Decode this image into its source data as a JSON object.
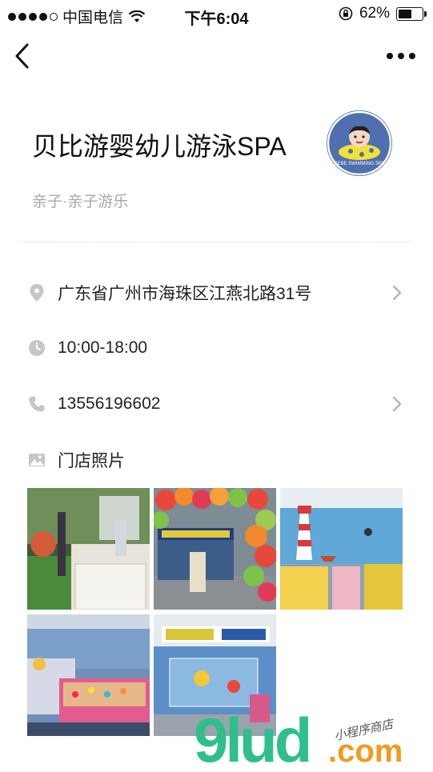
{
  "status_bar": {
    "carrier": "中国电信",
    "time": "下午6:04",
    "battery": "62%",
    "battery_level": 0.62
  },
  "nav": {
    "back_icon": "chevron-left-icon",
    "more_icon": "more-dots-icon"
  },
  "store": {
    "name": "贝比游婴幼儿游泳SPA",
    "category": "亲子·亲子游乐",
    "avatar_text": "BEBE SWIMMING SPA"
  },
  "details": {
    "address": "广东省广州市海珠区江燕北路31号",
    "hours": "10:00-18:00",
    "phone": "13556196602",
    "photos_label": "门店照片"
  },
  "photos": [
    {
      "name": "pool-area-photo",
      "palette": [
        "#2e4b2a",
        "#9c6f40"
      ]
    },
    {
      "name": "storefront-balloons-photo",
      "palette": [
        "#e9473b",
        "#7fc24a"
      ]
    },
    {
      "name": "lighthouse-mural-photo",
      "palette": [
        "#4fa3d6",
        "#f2c84b"
      ]
    },
    {
      "name": "swim-tubs-photo",
      "palette": [
        "#d65a8a",
        "#6a8ebf"
      ]
    },
    {
      "name": "shop-entrance-photo",
      "palette": [
        "#2f4f7a",
        "#d6c73a"
      ]
    }
  ],
  "watermark": {
    "main": "9lud",
    "suffix": ".com",
    "tag": "小程序商店"
  },
  "colors": {
    "icon_gray": "#c6c6c6",
    "text_muted": "#a8a8a8",
    "watermark_green": "#2fbf8c",
    "watermark_orange": "#f29a1e"
  }
}
